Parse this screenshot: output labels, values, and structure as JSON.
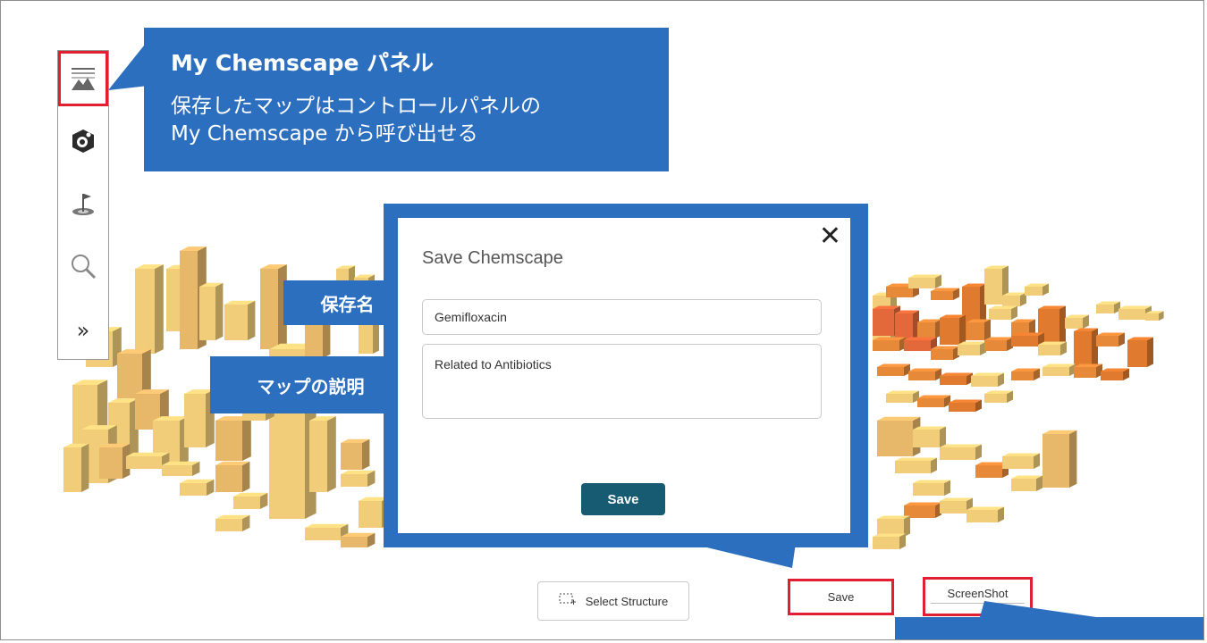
{
  "toolbar": {
    "items": [
      {
        "icon": "landscape-icon",
        "highlighted": true
      },
      {
        "icon": "chemscape-logo-icon"
      },
      {
        "icon": "flag-target-icon"
      },
      {
        "icon": "search-icon"
      },
      {
        "icon": "chevron-double-right-icon",
        "glyph": "»"
      }
    ]
  },
  "callout_top": {
    "title": "My Chemscape パネル",
    "body_lines": [
      "保存したマップはコントロールパネルの",
      "My Chemscape から呼び出せる"
    ]
  },
  "labels": {
    "save_name": "保存名",
    "map_description": "マップの説明"
  },
  "modal": {
    "title": "Save Chemscape",
    "close_glyph": "✕",
    "name_value": "Gemifloxacin",
    "description_value": "Related to Antibiotics",
    "save_label": "Save"
  },
  "bottom": {
    "select_structure_label": "Select Structure",
    "save_label": "Save",
    "screenshot_label": "ScreenShot"
  },
  "colors": {
    "accent_blue": "#2d6fbf",
    "highlight_red": "#e02030",
    "modal_button": "#175b72",
    "bar_yellow": "#f1cd79",
    "bar_orange": "#e68a3a"
  }
}
